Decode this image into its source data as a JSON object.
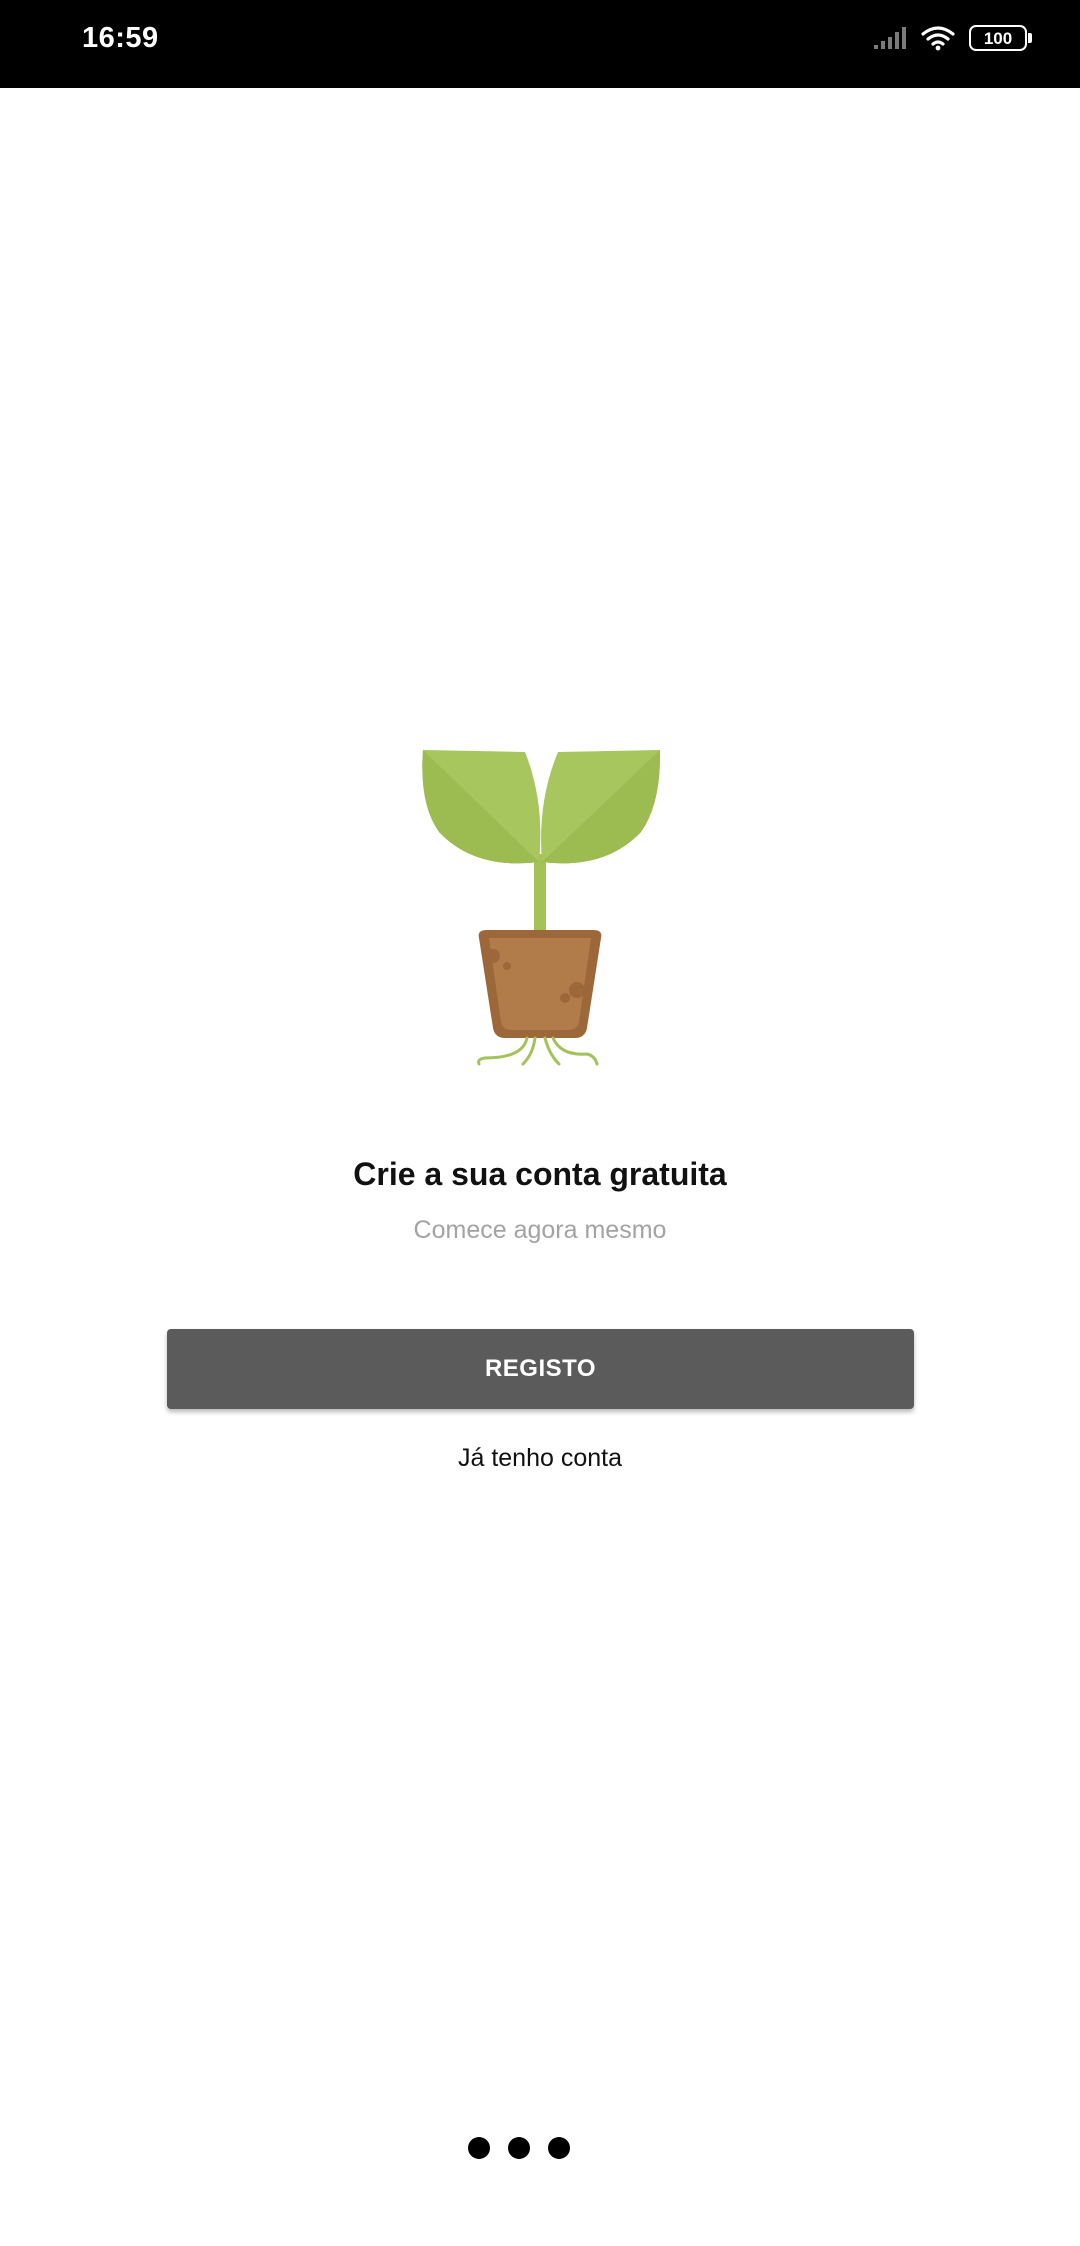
{
  "status_bar": {
    "time": "16:59",
    "battery": "100",
    "icons": [
      "signal-icon",
      "wifi-icon",
      "battery-icon"
    ]
  },
  "illustration": {
    "icon": "plant-sprout-icon",
    "colors": {
      "leaf": "#a3c25a",
      "leaf_dark": "#98b84f",
      "stem": "#a3c25a",
      "pot": "#b27b4a",
      "pot_rim": "#9c6839",
      "roots": "#a3c25a"
    }
  },
  "onboarding": {
    "title": "Crie a sua conta gratuita",
    "subtitle": "Comece agora mesmo",
    "register_button": "REGISTO",
    "login_link": "Já tenho conta"
  },
  "pager": {
    "page_count": 3
  },
  "colors": {
    "button_background": "#5b5b5c",
    "subtitle_text": "#a3a3a3",
    "status_bar": "#000000"
  }
}
